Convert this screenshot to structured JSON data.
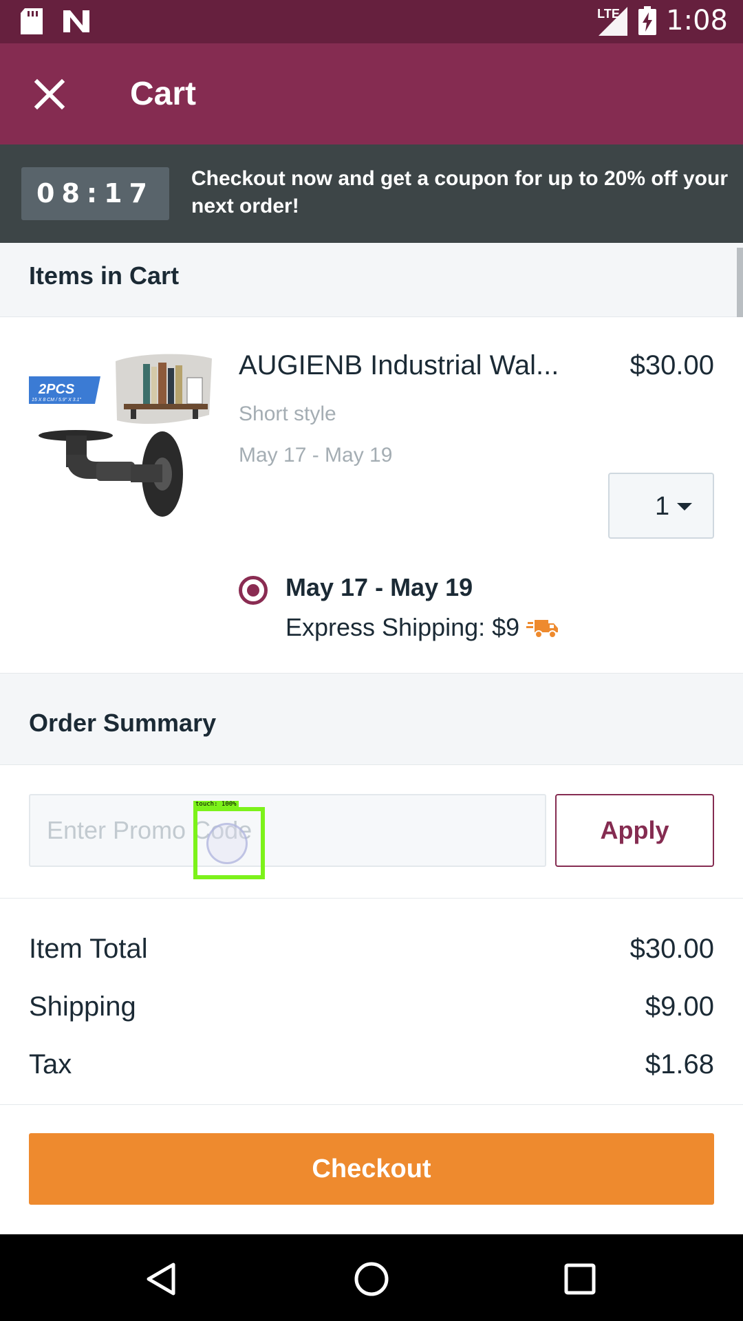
{
  "status_bar": {
    "time": "1:08",
    "network_label": "LTE",
    "icons": [
      "sd-card-icon",
      "n-notification-icon",
      "signal-icon",
      "battery-charging-icon"
    ]
  },
  "app_bar": {
    "title": "Cart",
    "close_icon": "close-icon"
  },
  "promo_banner": {
    "timer": "08:17",
    "message": "Checkout now and get a coupon for up to 20% off your next order!"
  },
  "items_section": {
    "header": "Items in Cart"
  },
  "cart_item": {
    "name": "AUGIENB Industrial Wal...",
    "price": "$30.00",
    "style": "Short style",
    "dates": "May 17 - May 19",
    "quantity": "1",
    "image_badge": "2PCS",
    "image_badge_sub": "15 X 8 CM / 5.9\" X 3.1\"",
    "shipping_option": {
      "dates": "May 17 - May 19",
      "method": "Express Shipping: $9",
      "selected": true,
      "icon": "truck-icon"
    }
  },
  "order_summary": {
    "header": "Order Summary",
    "promo_placeholder": "Enter Promo Code",
    "apply_label": "Apply",
    "lines": [
      {
        "label": "Item Total",
        "amount": "$30.00"
      },
      {
        "label": "Shipping",
        "amount": "$9.00"
      },
      {
        "label": "Tax",
        "amount": "$1.68"
      }
    ]
  },
  "checkout_label": "Checkout",
  "touch_overlay": {
    "label": "touch: 100%"
  },
  "colors": {
    "status_bar": "#66203e",
    "app_bar": "#852c51",
    "banner": "#3d4547",
    "accent": "#852c51",
    "checkout": "#ee8a2e"
  }
}
